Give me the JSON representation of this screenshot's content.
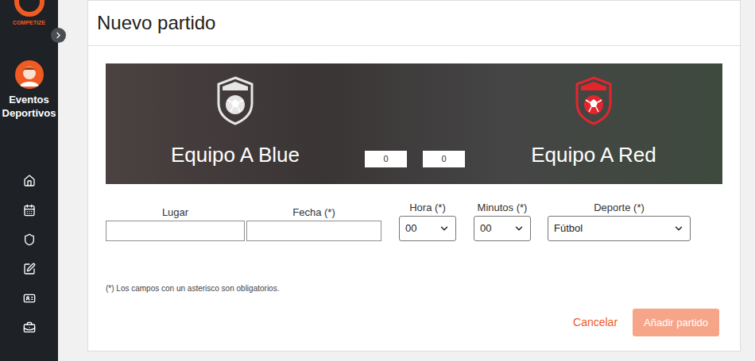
{
  "sidebar": {
    "brand": "COMPETIZE",
    "user": "Eventos Deportivos"
  },
  "page": {
    "title": "Nuevo partido"
  },
  "match": {
    "teams": [
      {
        "name": "Equipo A Blue",
        "score": "0",
        "color": "#e6e6e6"
      },
      {
        "name": "Equipo A Red",
        "score": "0",
        "color": "#e3262d"
      }
    ]
  },
  "fields": [
    {
      "label": "Lugar",
      "value": "",
      "kind": "text"
    },
    {
      "label": "Fecha (*)",
      "value": "",
      "kind": "text"
    },
    {
      "label": "Hora (*)",
      "value": "00",
      "kind": "select"
    },
    {
      "label": "Minutos (*)",
      "value": "00",
      "kind": "select"
    },
    {
      "label": "Deporte (*)",
      "value": "Fútbol",
      "kind": "select"
    }
  ],
  "note": "(*) Los campos con un asterisco son obligatorios.",
  "buttons": {
    "cancel": "Cancelar",
    "submit": "Añadir partido"
  }
}
